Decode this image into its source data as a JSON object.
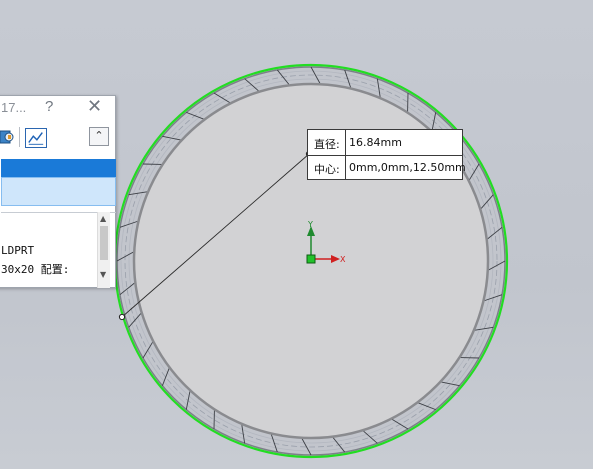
{
  "panel": {
    "title_partial": "17...",
    "help_icon": "?",
    "close_icon": "✕",
    "collapse_icon": "⌃",
    "list": {
      "line1": "LDPRT",
      "line2": "30x20 配置:"
    },
    "icons": [
      "assembly-icon",
      "chart-icon"
    ]
  },
  "tooltip": {
    "diameter_label": "直径:",
    "diameter_value": "16.84mm",
    "center_label": "中心:",
    "center_value": "0mm,0mm,12.50mm"
  },
  "triad": {
    "y_label": "Y",
    "x_label": "X"
  },
  "colors": {
    "highlight_circle": "#22dd22",
    "triad_y": "#1f8a2f",
    "triad_x": "#d02020",
    "selection_blue": "#1a7ad8"
  }
}
